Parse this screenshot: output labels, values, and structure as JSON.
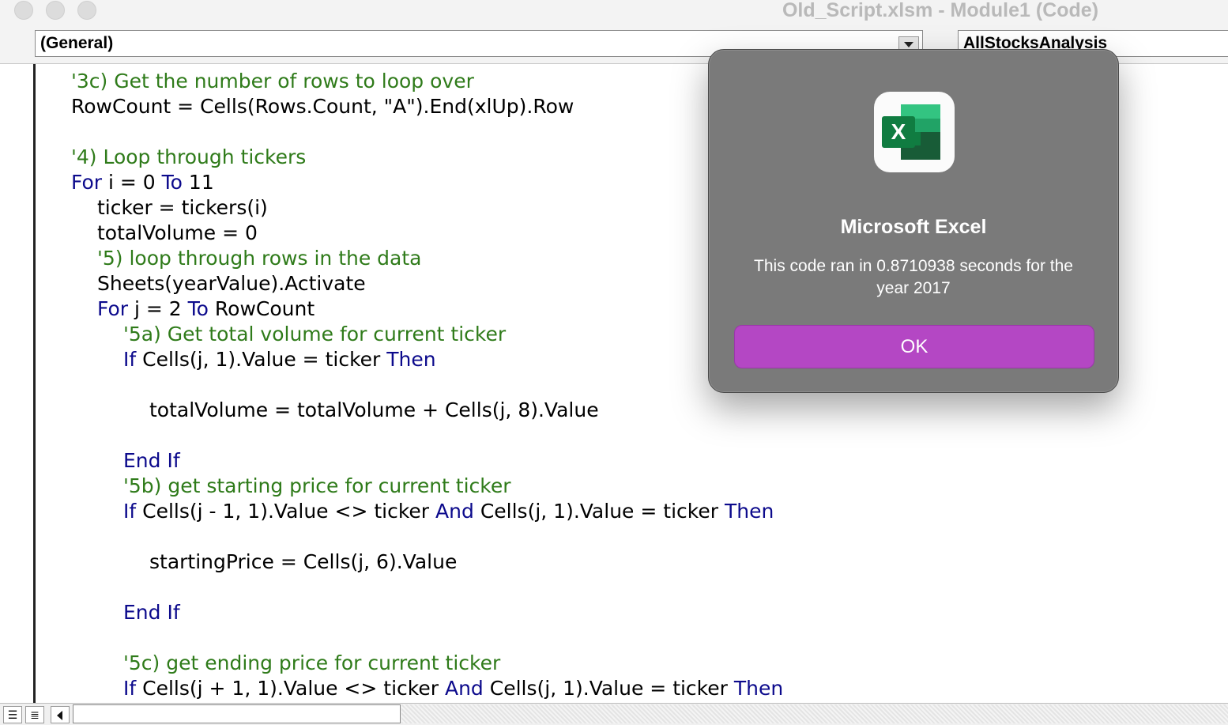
{
  "window": {
    "title": "Old_Script.xlsm - Module1 (Code)"
  },
  "selectors": {
    "object": "(General)",
    "procedure": "AllStocksAnalysis"
  },
  "code_lines": [
    {
      "indent": 0,
      "tokens": [
        {
          "type": "comment",
          "text": "'3c) Get the number of rows to loop over"
        }
      ]
    },
    {
      "indent": 0,
      "tokens": [
        {
          "type": "text",
          "text": "RowCount = Cells(Rows.Count, \"A\").End(xlUp).Row"
        }
      ]
    },
    {
      "indent": 0,
      "tokens": []
    },
    {
      "indent": 0,
      "tokens": [
        {
          "type": "comment",
          "text": "'4) Loop through tickers"
        }
      ]
    },
    {
      "indent": 0,
      "tokens": [
        {
          "type": "keyword",
          "text": "For"
        },
        {
          "type": "text",
          "text": " i = 0 "
        },
        {
          "type": "keyword",
          "text": "To"
        },
        {
          "type": "text",
          "text": " 11"
        }
      ]
    },
    {
      "indent": 1,
      "tokens": [
        {
          "type": "text",
          "text": "ticker = tickers(i)"
        }
      ]
    },
    {
      "indent": 1,
      "tokens": [
        {
          "type": "text",
          "text": "totalVolume = 0"
        }
      ]
    },
    {
      "indent": 1,
      "tokens": [
        {
          "type": "comment",
          "text": "'5) loop through rows in the data"
        }
      ]
    },
    {
      "indent": 1,
      "tokens": [
        {
          "type": "text",
          "text": "Sheets(yearValue).Activate"
        }
      ]
    },
    {
      "indent": 1,
      "tokens": [
        {
          "type": "keyword",
          "text": "For"
        },
        {
          "type": "text",
          "text": " j = 2 "
        },
        {
          "type": "keyword",
          "text": "To"
        },
        {
          "type": "text",
          "text": " RowCount"
        }
      ]
    },
    {
      "indent": 2,
      "tokens": [
        {
          "type": "comment",
          "text": "'5a) Get total volume for current ticker"
        }
      ]
    },
    {
      "indent": 2,
      "tokens": [
        {
          "type": "keyword",
          "text": "If"
        },
        {
          "type": "text",
          "text": " Cells(j, 1).Value = ticker "
        },
        {
          "type": "keyword",
          "text": "Then"
        }
      ]
    },
    {
      "indent": 0,
      "tokens": []
    },
    {
      "indent": 3,
      "tokens": [
        {
          "type": "text",
          "text": "totalVolume = totalVolume + Cells(j, 8).Value"
        }
      ]
    },
    {
      "indent": 0,
      "tokens": []
    },
    {
      "indent": 2,
      "tokens": [
        {
          "type": "keyword",
          "text": "End If"
        }
      ]
    },
    {
      "indent": 2,
      "tokens": [
        {
          "type": "comment",
          "text": "'5b) get starting price for current ticker"
        }
      ]
    },
    {
      "indent": 2,
      "tokens": [
        {
          "type": "keyword",
          "text": "If"
        },
        {
          "type": "text",
          "text": " Cells(j - 1, 1).Value <> ticker "
        },
        {
          "type": "keyword",
          "text": "And"
        },
        {
          "type": "text",
          "text": " Cells(j, 1).Value = ticker "
        },
        {
          "type": "keyword",
          "text": "Then"
        }
      ]
    },
    {
      "indent": 0,
      "tokens": []
    },
    {
      "indent": 3,
      "tokens": [
        {
          "type": "text",
          "text": "startingPrice = Cells(j, 6).Value"
        }
      ]
    },
    {
      "indent": 0,
      "tokens": []
    },
    {
      "indent": 2,
      "tokens": [
        {
          "type": "keyword",
          "text": "End If"
        }
      ]
    },
    {
      "indent": 0,
      "tokens": []
    },
    {
      "indent": 2,
      "tokens": [
        {
          "type": "comment",
          "text": "'5c) get ending price for current ticker"
        }
      ]
    },
    {
      "indent": 2,
      "tokens": [
        {
          "type": "keyword",
          "text": "If"
        },
        {
          "type": "text",
          "text": " Cells(j + 1, 1).Value <> ticker "
        },
        {
          "type": "keyword",
          "text": "And"
        },
        {
          "type": "text",
          "text": " Cells(j, 1).Value = ticker "
        },
        {
          "type": "keyword",
          "text": "Then"
        }
      ]
    }
  ],
  "dialog": {
    "app_name": "Microsoft Excel",
    "icon": "excel-app-icon",
    "icon_letter": "X",
    "message": "This code ran in 0.8710938 seconds for the year 2017",
    "ok_label": "OK"
  },
  "colors": {
    "comment": "#2f7b1a",
    "keyword": "#0c0a8c",
    "dialog_bg": "#7a7a7a",
    "ok_button": "#b447c4"
  }
}
